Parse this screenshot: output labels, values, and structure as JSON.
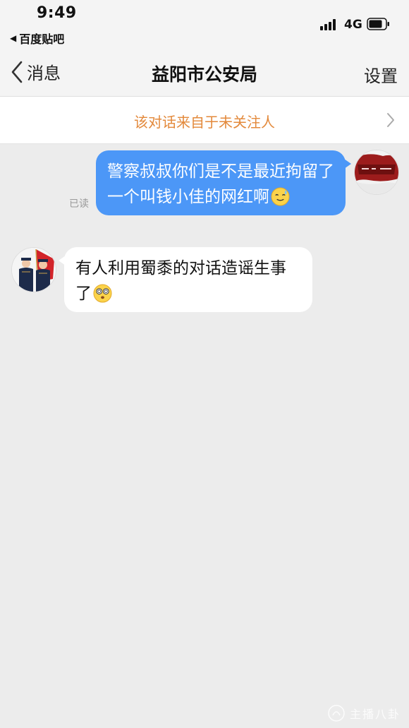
{
  "status_bar": {
    "time": "9:49",
    "back_app": "百度贴吧",
    "back_arrow": "◀",
    "network": "4G"
  },
  "nav": {
    "back_label": "消息",
    "title": "益阳市公安局",
    "settings_label": "设置"
  },
  "banner": {
    "text": "该对话来自于未关注人"
  },
  "messages": [
    {
      "direction": "sent",
      "text": "警察叔叔你们是不是最近拘留了一个叫钱小佳的网红啊",
      "emoji": "sweat-smile-emoji",
      "status": "已读"
    },
    {
      "direction": "received",
      "text": "有人利用蜀黍的对话造谣生事了",
      "emoji": "dizzy-face-emoji"
    }
  ],
  "watermark": {
    "text": "主播八卦"
  },
  "colors": {
    "sent_bubble": "#4c97f7",
    "banner_text": "#e3893b",
    "background": "#ececec"
  }
}
